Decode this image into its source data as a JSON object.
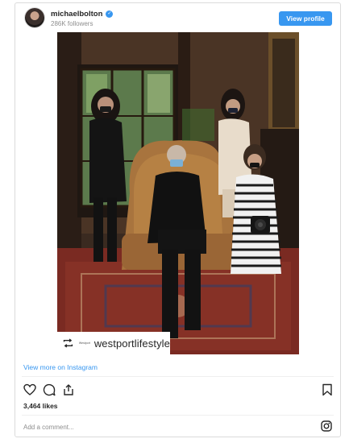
{
  "post": {
    "username": "michaelbolton",
    "followers": "286K followers",
    "view_profile_label": "View profile",
    "repost_handle": "westportlifestyle",
    "repost_logo_text": "Westport",
    "view_more_label": "View more on Instagram",
    "likes": "3,464 likes",
    "comment_placeholder": "Add a comment...",
    "verified_glyph": "✓"
  },
  "colors": {
    "accent": "#3897f0",
    "border": "#dbdbdb",
    "muted": "#8e8e8e",
    "text": "#262626"
  },
  "icons": {
    "verified": "verified-badge-icon",
    "repost": "repost-icon",
    "like": "heart-icon",
    "comment": "comment-icon",
    "share": "share-icon",
    "save": "bookmark-icon",
    "instagram": "instagram-logo-icon"
  }
}
